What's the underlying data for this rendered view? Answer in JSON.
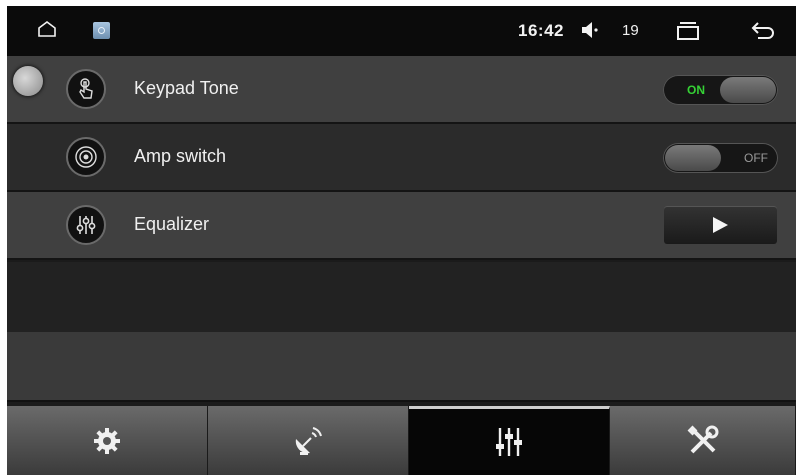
{
  "status_bar": {
    "time": "16:42",
    "volume": "19",
    "icons": [
      "home-icon",
      "app-settings-icon",
      "volume-icon",
      "recent-apps-icon",
      "back-icon"
    ]
  },
  "settings": [
    {
      "label": "Keypad Tone",
      "icon": "touch-hand-icon",
      "control": "toggle",
      "state": "ON"
    },
    {
      "label": "Amp switch",
      "icon": "speaker-icon",
      "control": "toggle",
      "state": "OFF"
    },
    {
      "label": "Equalizer",
      "icon": "equalizer-icon",
      "control": "play-button"
    }
  ],
  "tabs": [
    {
      "icon": "gear-icon",
      "active": false
    },
    {
      "icon": "satellite-dish-icon",
      "active": false
    },
    {
      "icon": "sliders-icon",
      "active": true
    },
    {
      "icon": "tools-icon",
      "active": false
    }
  ],
  "colors": {
    "toggle_on_text": "#35d135",
    "toggle_off_text": "#9a9a9a",
    "row_light": "#404040",
    "row_dark": "#2b2b2b"
  }
}
